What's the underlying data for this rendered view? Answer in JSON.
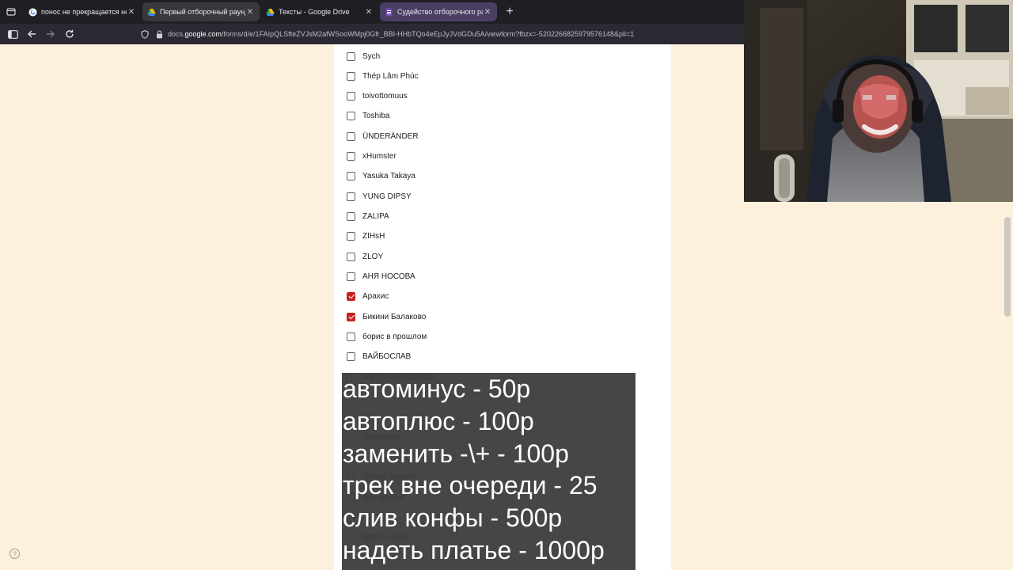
{
  "browser": {
    "tabs": [
      {
        "title": "понос не прекращается неделю",
        "favicon": "google-icon",
        "active": false
      },
      {
        "title": "Первый отборочный раунд",
        "favicon": "drive-icon",
        "active": true
      },
      {
        "title": "Тексты - Google Drive",
        "favicon": "drive-icon",
        "active": false
      },
      {
        "title": "Судейство отборочного раунда",
        "favicon": "forms-icon",
        "active": false
      }
    ],
    "url_prefix": "docs.",
    "url_domain": "google.com",
    "url_path": "/forms/d/e/1FAIpQLSfteZVJsM2afWSooWMpj0Gfr_BBI-HHbTQo4eEpJyJVdGDu5A/viewform?fbzx=-5202266825979576148&pli=1"
  },
  "form": {
    "options": [
      {
        "label": "Sych",
        "checked": false
      },
      {
        "label": "Thép Lâm Phúc",
        "checked": false
      },
      {
        "label": "toivottomuus",
        "checked": false
      },
      {
        "label": "Toshiba",
        "checked": false
      },
      {
        "label": "ÜNDERÄNDER",
        "checked": false
      },
      {
        "label": "xHumster",
        "checked": false
      },
      {
        "label": "Yasuka Takaya",
        "checked": false
      },
      {
        "label": "YUNG DIPSY",
        "checked": false
      },
      {
        "label": "ZALIPA",
        "checked": false
      },
      {
        "label": "ZIHsH",
        "checked": false
      },
      {
        "label": "ZLOY",
        "checked": false
      },
      {
        "label": "АНЯ НОСОВА",
        "checked": false
      },
      {
        "label": "Арахис",
        "checked": true
      },
      {
        "label": "Бикини Балаково",
        "checked": true
      },
      {
        "label": "борис в прошлом",
        "checked": false
      },
      {
        "label": "ВАЙБОСЛАВ",
        "checked": false
      },
      {
        "label": "вертушка газротова",
        "checked": false
      },
      {
        "label": "",
        "checked": false
      },
      {
        "label": "",
        "checked": false
      },
      {
        "label": "Тигатигаль",
        "checked": false
      },
      {
        "label": "",
        "checked": false
      },
      {
        "label": "Густав Тролле",
        "checked": false
      },
      {
        "label": "Дан Дыдык",
        "checked": false
      },
      {
        "label": "",
        "checked": false
      },
      {
        "label": "Девять Zazo",
        "checked": false
      }
    ]
  },
  "overlay": {
    "lines": [
      "автоминус - 50р",
      "автоплюс - 100р",
      "заменить -\\+ - 100р",
      "трек вне очереди - 25",
      "слив конфы - 500р",
      "надеть платье - 1000р"
    ]
  },
  "colors": {
    "page_background": "#fdf0dc",
    "checkbox_checked": "#c5221f",
    "tab_bar": "#1f1f23"
  }
}
